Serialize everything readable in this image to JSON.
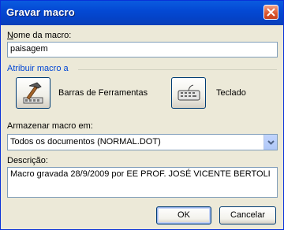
{
  "window": {
    "title": "Gravar macro"
  },
  "macro_name": {
    "label": "Nome da macro:",
    "value": "paisagem"
  },
  "assign": {
    "label": "Atribuir macro a",
    "toolbars_label": "Barras de Ferramentas",
    "keyboard_label": "Teclado"
  },
  "store": {
    "label": "Armazenar macro em:",
    "value": "Todos os documentos (NORMAL.DOT)"
  },
  "description": {
    "label": "Descrição:",
    "value": "Macro gravada 28/9/2009 por EE PROF. JOSÉ VICENTE BERTOLI"
  },
  "buttons": {
    "ok": "OK",
    "cancel": "Cancelar"
  },
  "colors": {
    "accent_label": "#0046d5",
    "title_bar": "#0449d4"
  },
  "icons": {
    "close": "close-icon",
    "toolbars": "hammer-toolbar-icon",
    "keyboard": "keyboard-icon",
    "dropdown": "chevron-down-icon"
  }
}
